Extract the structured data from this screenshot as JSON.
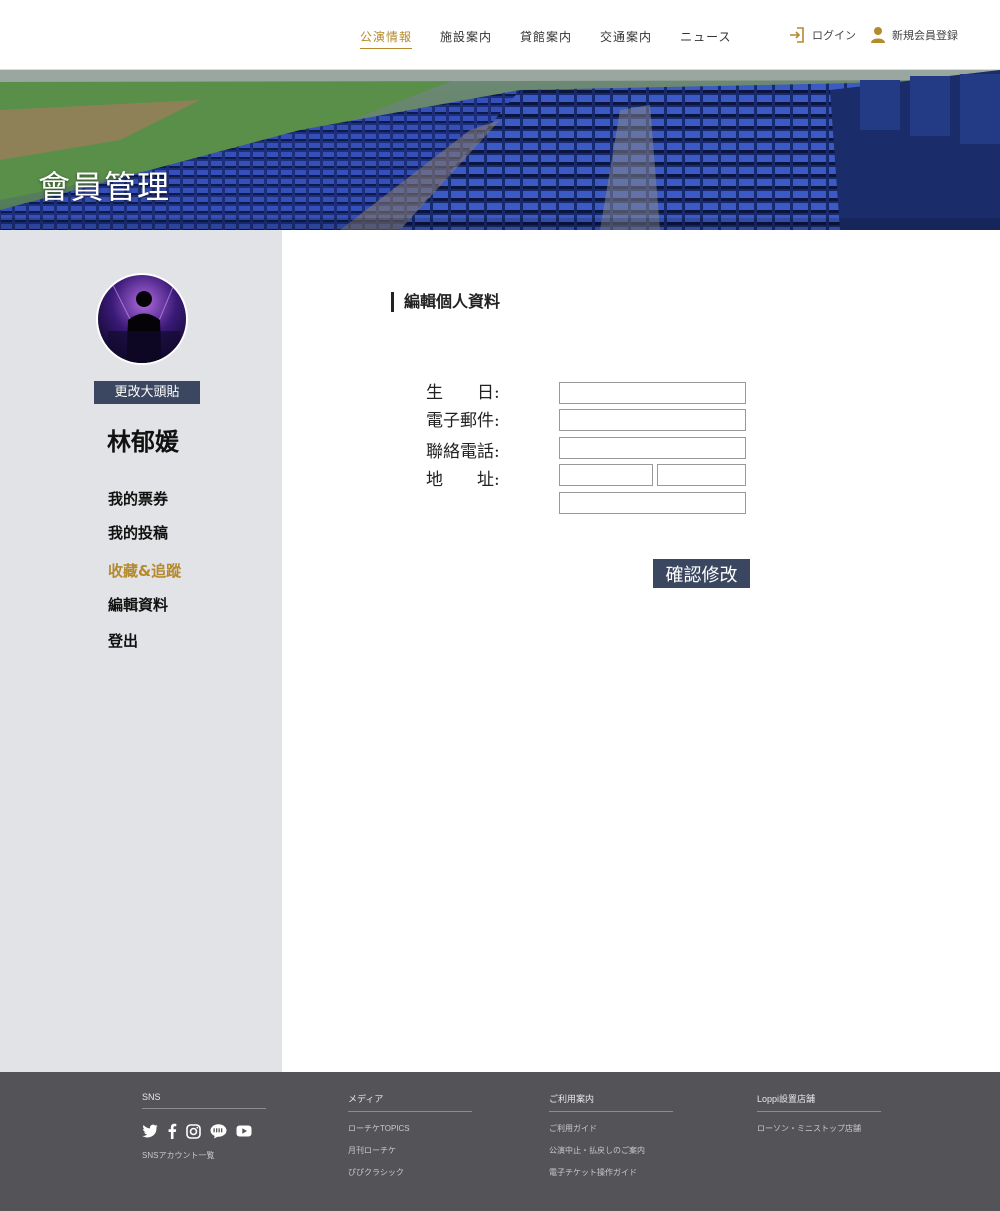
{
  "header": {
    "nav": [
      {
        "label": "公演情報",
        "active": true
      },
      {
        "label": "施設案内",
        "active": false
      },
      {
        "label": "貸館案内",
        "active": false
      },
      {
        "label": "交通案内",
        "active": false
      },
      {
        "label": "ニュース",
        "active": false
      }
    ],
    "login_label": "ログイン",
    "register_label": "新規会員登録",
    "accent_color": "#b48a2c"
  },
  "banner": {
    "title": "會員管理"
  },
  "sidebar": {
    "change_avatar_label": "更改大頭貼",
    "user_name": "林郁媛",
    "menu": [
      {
        "label": "我的票券",
        "active": false
      },
      {
        "label": "我的投稿",
        "active": false
      },
      {
        "label": "收藏&追蹤",
        "active": true
      },
      {
        "label": "編輯資料",
        "active": false
      },
      {
        "label": "登出",
        "active": false
      }
    ]
  },
  "main": {
    "section_title": "編輯個人資料",
    "fields": {
      "birthday_label": "生　　日:",
      "email_label": "電子郵件:",
      "phone_label": "聯絡電話:",
      "address_label": "地　　址:",
      "birthday_value": "",
      "email_value": "",
      "phone_value": "",
      "address_city_value": "",
      "address_district_value": "",
      "address_street_value": ""
    },
    "submit_label": "確認修改"
  },
  "footer": {
    "columns": [
      {
        "title": "SNS",
        "links": [
          "SNSアカウント一覧"
        ]
      },
      {
        "title": "メディア",
        "links": [
          "ローチケTOPICS",
          "月刊ローチケ",
          "ぴぴクラシック"
        ]
      },
      {
        "title": "ご利用案内",
        "links": [
          "ご利用ガイド",
          "公演中止・払戻しのご案内",
          "電子チケット操作ガイド"
        ]
      },
      {
        "title": "Loppi設置店舗",
        "links": [
          "ローソン・ミニストップ店舗"
        ]
      }
    ],
    "sns_icons": [
      "twitter-icon",
      "facebook-icon",
      "instagram-icon",
      "line-icon",
      "youtube-icon"
    ],
    "background_color": "#535358"
  }
}
